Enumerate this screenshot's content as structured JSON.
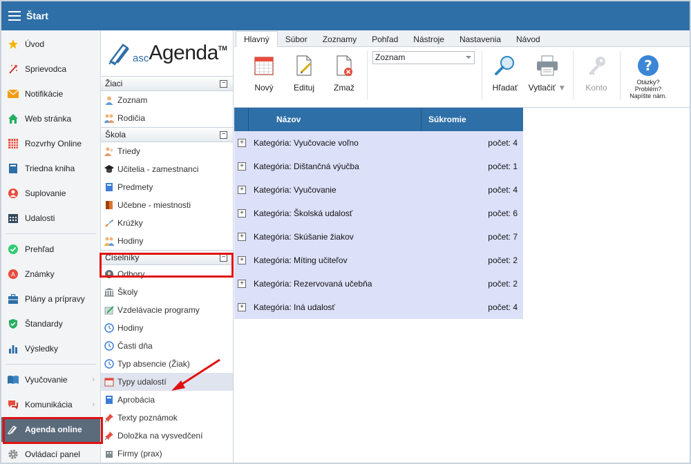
{
  "topbar": {
    "title": "Štart"
  },
  "leftnav": {
    "group1": [
      {
        "label": "Úvod",
        "icon": "star-icon"
      },
      {
        "label": "Sprievodca",
        "icon": "magic-wand-icon"
      },
      {
        "label": "Notifikácie",
        "icon": "envelope-icon"
      },
      {
        "label": "Web stránka",
        "icon": "house-icon"
      },
      {
        "label": "Rozvrhy Online",
        "icon": "timetable-icon"
      },
      {
        "label": "Triedna kniha",
        "icon": "book-icon"
      },
      {
        "label": "Suplovanie",
        "icon": "substitution-icon"
      },
      {
        "label": "Udalosti",
        "icon": "calendar-icon"
      }
    ],
    "group2": [
      {
        "label": "Prehľad",
        "icon": "check-circle-icon"
      },
      {
        "label": "Známky",
        "icon": "grades-icon"
      },
      {
        "label": "Plány a prípravy",
        "icon": "briefcase-icon"
      },
      {
        "label": "Štandardy",
        "icon": "shield-check-icon"
      },
      {
        "label": "Výsledky",
        "icon": "bar-chart-icon"
      }
    ],
    "group3": [
      {
        "label": "Vyučovanie",
        "icon": "open-book-icon"
      },
      {
        "label": "Komunikácia",
        "icon": "chat-icon"
      },
      {
        "label": "Agenda online",
        "icon": "pen-icon"
      },
      {
        "label": "Ovládací panel",
        "icon": "gear-icon"
      }
    ]
  },
  "logo": {
    "asc": "asc",
    "agenda": "Agenda",
    "tm": "TM"
  },
  "subpanel": {
    "ziaci": {
      "title": "Žiaci",
      "items": [
        "Zoznam",
        "Rodičia"
      ]
    },
    "skola": {
      "title": "Škola",
      "items": [
        "Triedy",
        "Učitelia - zamestnanci",
        "Predmety",
        "Učebne - miestnosti",
        "Krúžky",
        "Hodiny"
      ]
    },
    "ciselniky": {
      "title": "Číselníky",
      "items": [
        "Odbory",
        "Školy",
        "Vzdelávacie programy",
        "Hodiny",
        "Časti dňa",
        "Typ absencie (Žiak)",
        "Typy udalostí",
        "Aprobácia",
        "Texty poznámok",
        "Doložka na vysvedčení",
        "Firmy (prax)"
      ]
    }
  },
  "tabs": [
    "Hlavný",
    "Súbor",
    "Zoznamy",
    "Pohľad",
    "Nástroje",
    "Nastavenia",
    "Návod"
  ],
  "ribbon": {
    "new": "Nový",
    "edit": "Edituj",
    "delete": "Zmaž",
    "view_select": "Zoznam",
    "search": "Hľadať",
    "print": "Vytlačiť",
    "account": "Konto",
    "help_line1": "Otázky?",
    "help_line2": "Problém?",
    "help_line3": "Napíšte nám."
  },
  "grid": {
    "col_name": "Názov",
    "col_private": "Súkromie",
    "rows": [
      {
        "name": "Kategória: Vyučovacie voľno",
        "count": "počet: 4"
      },
      {
        "name": "Kategória: Dištančná výučba",
        "count": "počet: 1"
      },
      {
        "name": "Kategória: Vyučovanie",
        "count": "počet: 4"
      },
      {
        "name": "Kategória: Školská udalosť",
        "count": "počet: 6"
      },
      {
        "name": "Kategória: Skúšanie žiakov",
        "count": "počet: 7"
      },
      {
        "name": "Kategória: Míting učiteľov",
        "count": "počet: 2"
      },
      {
        "name": "Kategória: Rezervovaná učebňa",
        "count": "počet: 2"
      },
      {
        "name": "Kategória: Iná udalosť",
        "count": "počet: 4"
      }
    ]
  },
  "colors": {
    "brand": "#2e6fa7",
    "highlight": "#e01010",
    "row_bg": "#dce0f9"
  }
}
